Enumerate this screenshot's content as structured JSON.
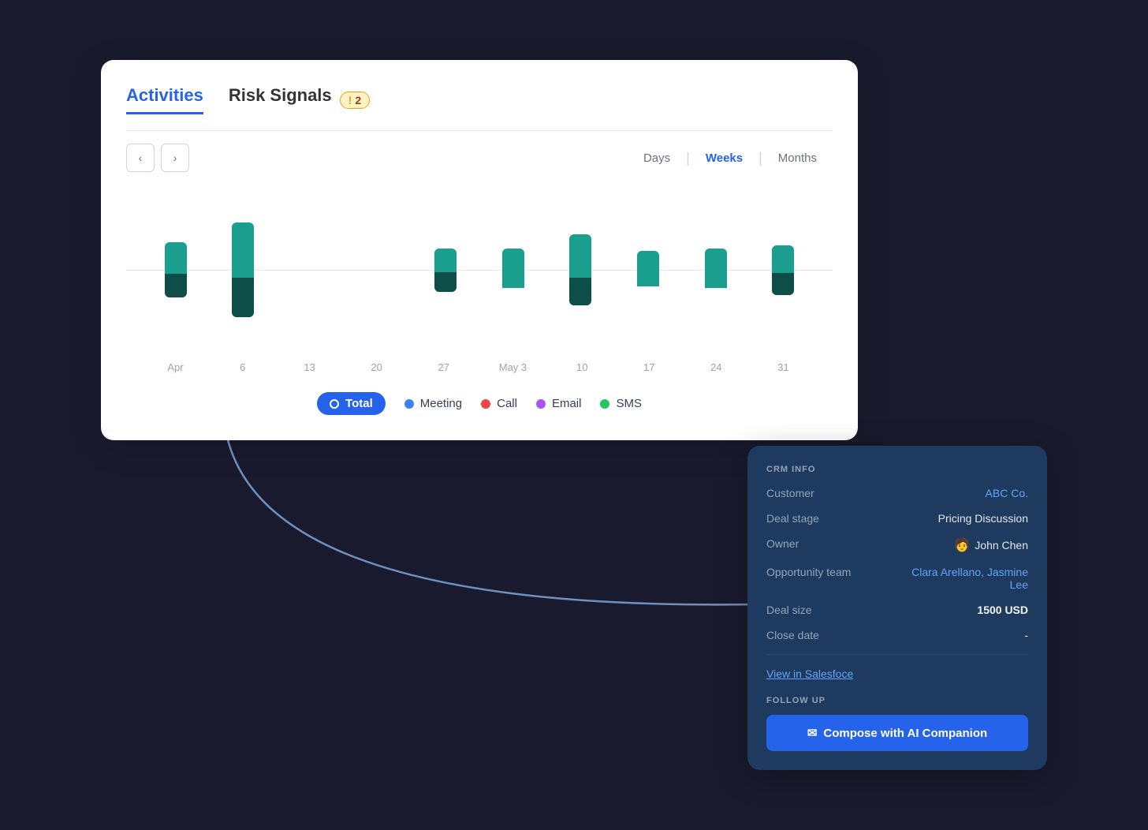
{
  "tabs": {
    "activities": "Activities",
    "riskSignals": "Risk Signals",
    "badgeCount": "2"
  },
  "viewControls": {
    "prevLabel": "‹",
    "nextLabel": "›",
    "periods": [
      "Days",
      "Weeks",
      "Months"
    ],
    "activePeriod": "Weeks"
  },
  "chart": {
    "bars": [
      {
        "label": "Apr",
        "upper": 40,
        "lower": 30
      },
      {
        "label": "6",
        "upper": 70,
        "lower": 50
      },
      {
        "label": "13",
        "upper": 0,
        "lower": 0
      },
      {
        "label": "20",
        "upper": 0,
        "lower": 0
      },
      {
        "label": "27",
        "upper": 30,
        "lower": 25
      },
      {
        "label": "May 3",
        "upper": 50,
        "lower": 0
      },
      {
        "label": "10",
        "upper": 55,
        "lower": 35
      },
      {
        "label": "17",
        "upper": 45,
        "lower": 0
      },
      {
        "label": "24",
        "upper": 50,
        "lower": 0
      },
      {
        "label": "31",
        "upper": 35,
        "lower": 30
      }
    ]
  },
  "legend": {
    "total": "Total",
    "meeting": "Meeting",
    "call": "Call",
    "email": "Email",
    "sms": "SMS",
    "meetingColor": "#3b82f6",
    "callColor": "#ef4444",
    "emailColor": "#a855f7",
    "smsColor": "#22c55e"
  },
  "crm": {
    "sectionLabel": "CRM INFO",
    "fields": [
      {
        "label": "Customer",
        "value": "ABC Co.",
        "type": "link"
      },
      {
        "label": "Deal stage",
        "value": "Pricing Discussion",
        "type": "text"
      },
      {
        "label": "Owner",
        "value": "John Chen",
        "type": "avatar"
      },
      {
        "label": "Opportunity team",
        "value": "Clara Arellano, Jasmine Lee",
        "type": "link"
      },
      {
        "label": "Deal size",
        "value": "1500 USD",
        "type": "bold"
      },
      {
        "label": "Close date",
        "value": "-",
        "type": "text"
      }
    ],
    "viewLinkLabel": "View in Salesfoce",
    "followUpLabel": "FOLLOW UP",
    "composeLabel": "Compose with AI Companion"
  }
}
